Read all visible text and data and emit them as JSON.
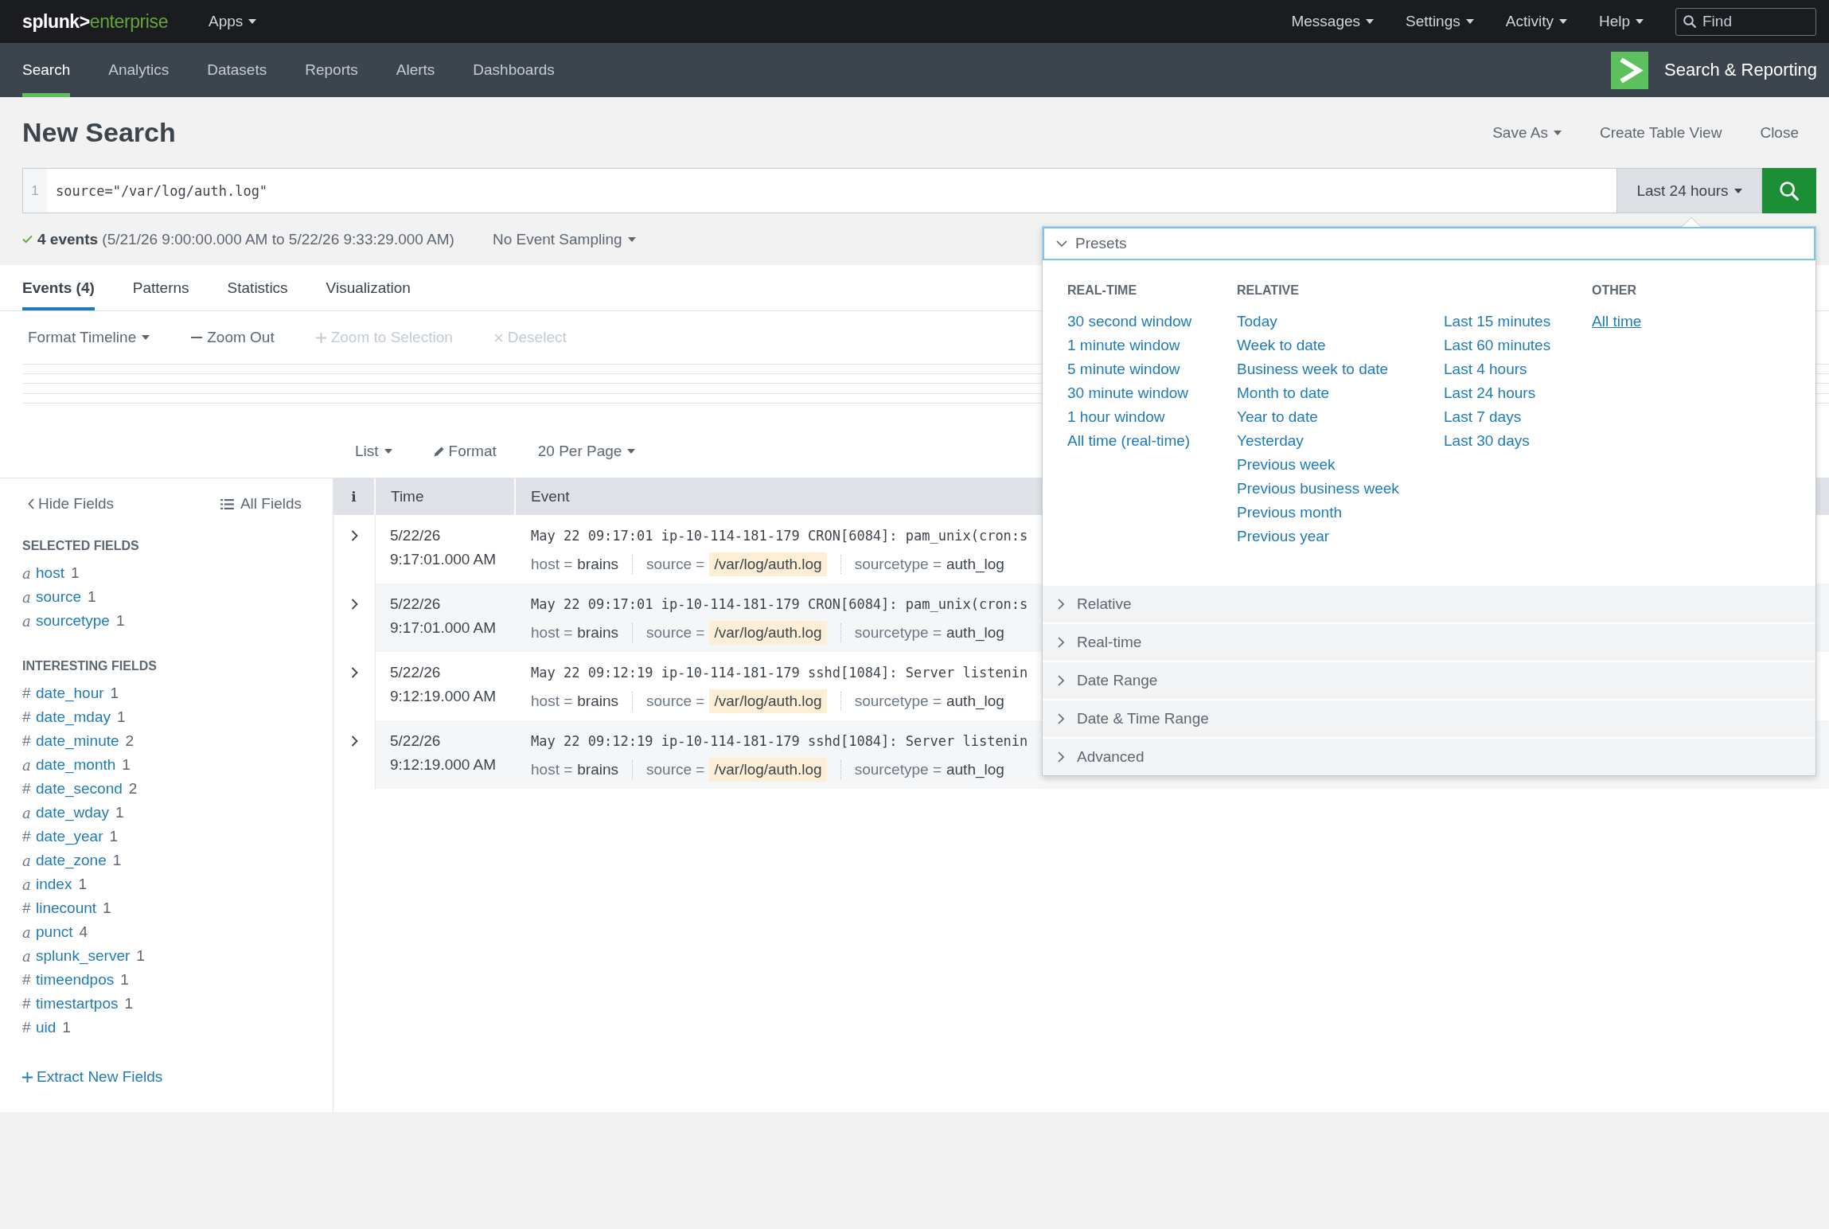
{
  "top_bar": {
    "logo": {
      "brand": "splunk>",
      "product": "enterprise"
    },
    "apps_menu": {
      "label": "Apps"
    },
    "menus": [
      {
        "label": "Messages"
      },
      {
        "label": "Settings"
      },
      {
        "label": "Activity"
      },
      {
        "label": "Help"
      }
    ],
    "find_field": {
      "placeholder": "Find"
    }
  },
  "app_bar": {
    "tabs": [
      {
        "label": "Search",
        "selected": true
      },
      {
        "label": "Analytics",
        "selected": false
      },
      {
        "label": "Datasets",
        "selected": false
      },
      {
        "label": "Reports",
        "selected": false
      },
      {
        "label": "Alerts",
        "selected": false
      },
      {
        "label": "Dashboards",
        "selected": false
      }
    ],
    "app_title": "Search & Reporting"
  },
  "page_header": {
    "title": "New Search",
    "actions": [
      {
        "kind": "menu",
        "label": "Save As"
      },
      {
        "kind": "link",
        "label": "Create Table View"
      },
      {
        "kind": "link",
        "label": "Close"
      }
    ]
  },
  "search_bar": {
    "line_number": "1",
    "query": "source=\"/var/log/auth.log\"",
    "time_range": {
      "label": "Last 24 hours",
      "open": true
    }
  },
  "job_status": {
    "complete": true,
    "summary": "**4 events** (5/21/26 9:00:00.000 AM to 5/22/26 9:33:29.000 AM)",
    "sampling": {
      "label": "No Event Sampling"
    }
  },
  "result_tabs": [
    {
      "label": "Events (4)",
      "selected": true
    },
    {
      "label": "Patterns",
      "selected": false
    },
    {
      "label": "Statistics",
      "selected": false
    },
    {
      "label": "Visualization",
      "selected": false
    }
  ],
  "timeline_toolbar": [
    {
      "kind": "menu",
      "label": "Format Timeline",
      "disabled": false
    },
    {
      "kind": "zoom_out",
      "label": "Zoom Out",
      "disabled": false
    },
    {
      "kind": "zoom_in",
      "label": "Zoom to Selection",
      "disabled": true
    },
    {
      "kind": "deselect",
      "label": "Deselect",
      "disabled": true
    }
  ],
  "results_toolbar": [
    {
      "kind": "menu",
      "label": "List"
    },
    {
      "kind": "edit",
      "label": "Format"
    },
    {
      "kind": "menu",
      "label": "20 Per Page"
    }
  ],
  "fields_sidebar": {
    "hide_button": "Hide Fields",
    "all_fields_button": "All Fields",
    "groups": [
      {
        "heading": "SELECTED FIELDS",
        "fields": [
          {
            "kind": "string",
            "symbol": "a",
            "name": "host",
            "count": "1"
          },
          {
            "kind": "string",
            "symbol": "a",
            "name": "source",
            "count": "1"
          },
          {
            "kind": "string",
            "symbol": "a",
            "name": "sourcetype",
            "count": "1"
          }
        ]
      },
      {
        "heading": "INTERESTING FIELDS",
        "fields": [
          {
            "kind": "number",
            "symbol": "#",
            "name": "date_hour",
            "count": "1"
          },
          {
            "kind": "number",
            "symbol": "#",
            "name": "date_mday",
            "count": "1"
          },
          {
            "kind": "number",
            "symbol": "#",
            "name": "date_minute",
            "count": "2"
          },
          {
            "kind": "string",
            "symbol": "a",
            "name": "date_month",
            "count": "1"
          },
          {
            "kind": "number",
            "symbol": "#",
            "name": "date_second",
            "count": "2"
          },
          {
            "kind": "string",
            "symbol": "a",
            "name": "date_wday",
            "count": "1"
          },
          {
            "kind": "number",
            "symbol": "#",
            "name": "date_year",
            "count": "1"
          },
          {
            "kind": "string",
            "symbol": "a",
            "name": "date_zone",
            "count": "1"
          },
          {
            "kind": "string",
            "symbol": "a",
            "name": "index",
            "count": "1"
          },
          {
            "kind": "number",
            "symbol": "#",
            "name": "linecount",
            "count": "1"
          },
          {
            "kind": "string",
            "symbol": "a",
            "name": "punct",
            "count": "4"
          },
          {
            "kind": "string",
            "symbol": "a",
            "name": "splunk_server",
            "count": "1"
          },
          {
            "kind": "number",
            "symbol": "#",
            "name": "timeendpos",
            "count": "1"
          },
          {
            "kind": "number",
            "symbol": "#",
            "name": "timestartpos",
            "count": "1"
          },
          {
            "kind": "number",
            "symbol": "#",
            "name": "uid",
            "count": "1"
          }
        ]
      }
    ],
    "extract_link": "Extract New Fields"
  },
  "events_table": {
    "columns": [
      "i",
      "Time",
      "Event"
    ],
    "rows": [
      {
        "expanded": false,
        "date": "5/22/26",
        "time": "9:17:01.000 AM",
        "raw": "May 22 09:17:01 ip-10-114-181-179 CRON[6084]: pam_unix(cron:s",
        "fields": [
          {
            "label": "host =",
            "value": "brains",
            "highlighted": false
          },
          {
            "label": "source =",
            "value": "/var/log/auth.log",
            "highlighted": true
          },
          {
            "label": "sourcetype =",
            "value": "auth_log",
            "highlighted": false
          }
        ]
      },
      {
        "expanded": false,
        "date": "5/22/26",
        "time": "9:17:01.000 AM",
        "raw": "May 22 09:17:01 ip-10-114-181-179 CRON[6084]: pam_unix(cron:s",
        "fields": [
          {
            "label": "host =",
            "value": "brains",
            "highlighted": false
          },
          {
            "label": "source =",
            "value": "/var/log/auth.log",
            "highlighted": true
          },
          {
            "label": "sourcetype =",
            "value": "auth_log",
            "highlighted": false
          }
        ]
      },
      {
        "expanded": false,
        "date": "5/22/26",
        "time": "9:12:19.000 AM",
        "raw": "May 22 09:12:19 ip-10-114-181-179 sshd[1084]: Server listenin",
        "fields": [
          {
            "label": "host =",
            "value": "brains",
            "highlighted": false
          },
          {
            "label": "source =",
            "value": "/var/log/auth.log",
            "highlighted": true
          },
          {
            "label": "sourcetype =",
            "value": "auth_log",
            "highlighted": false
          }
        ]
      },
      {
        "expanded": false,
        "date": "5/22/26",
        "time": "9:12:19.000 AM",
        "raw": "May 22 09:12:19 ip-10-114-181-179 sshd[1084]: Server listenin",
        "fields": [
          {
            "label": "host =",
            "value": "brains",
            "highlighted": false
          },
          {
            "label": "source =",
            "value": "/var/log/auth.log",
            "highlighted": true
          },
          {
            "label": "sourcetype =",
            "value": "auth_log",
            "highlighted": false
          }
        ]
      }
    ]
  },
  "time_range_menu": {
    "sections": [
      {
        "label": "Presets",
        "expanded": true,
        "columns": [
          {
            "heading": "REAL-TIME",
            "items": [
              {
                "label": "30 second window",
                "hovered": false
              },
              {
                "label": "1 minute window",
                "hovered": false
              },
              {
                "label": "5 minute window",
                "hovered": false
              },
              {
                "label": "30 minute window",
                "hovered": false
              },
              {
                "label": "1 hour window",
                "hovered": false
              },
              {
                "label": "All time (real-time)",
                "hovered": false
              }
            ]
          },
          {
            "heading": "RELATIVE",
            "items": [
              {
                "label": "Today",
                "hovered": false
              },
              {
                "label": "Week to date",
                "hovered": false
              },
              {
                "label": "Business week to date",
                "hovered": false
              },
              {
                "label": "Month to date",
                "hovered": false
              },
              {
                "label": "Year to date",
                "hovered": false
              },
              {
                "label": "Yesterday",
                "hovered": false
              },
              {
                "label": "Previous week",
                "hovered": false
              },
              {
                "label": "Previous business week",
                "hovered": false
              },
              {
                "label": "Previous month",
                "hovered": false
              },
              {
                "label": "Previous year",
                "hovered": false
              }
            ]
          },
          {
            "items": [
              {
                "label": "Last 15 minutes",
                "hovered": false
              },
              {
                "label": "Last 60 minutes",
                "hovered": false
              },
              {
                "label": "Last 4 hours",
                "hovered": false
              },
              {
                "label": "Last 24 hours",
                "hovered": false
              },
              {
                "label": "Last 7 days",
                "hovered": false
              },
              {
                "label": "Last 30 days",
                "hovered": false
              }
            ]
          },
          {
            "heading": "OTHER",
            "items": [
              {
                "label": "All time",
                "hovered": true
              }
            ]
          }
        ]
      },
      {
        "label": "Relative",
        "expanded": false
      },
      {
        "label": "Real-time",
        "expanded": false
      },
      {
        "label": "Date Range",
        "expanded": false
      },
      {
        "label": "Date & Time Range",
        "expanded": false
      },
      {
        "label": "Advanced",
        "expanded": false
      }
    ]
  }
}
